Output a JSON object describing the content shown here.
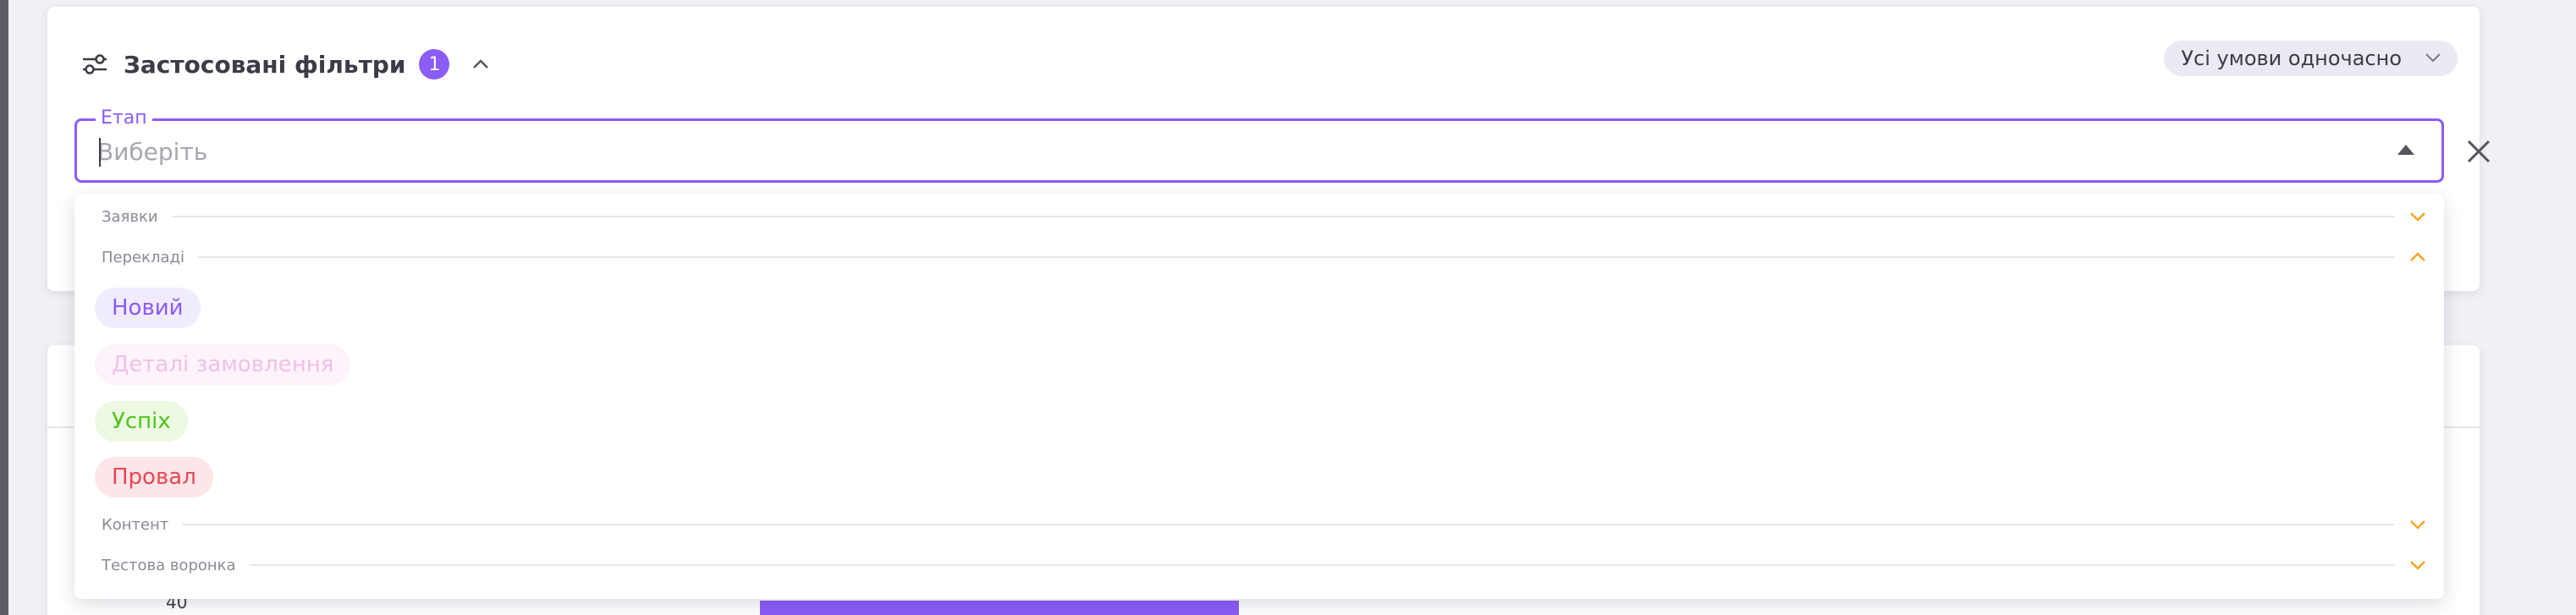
{
  "filters": {
    "title": "Застосовані фільтри",
    "count": "1",
    "mode": "Усі умови одночасно"
  },
  "stage_field": {
    "label": "Етап",
    "placeholder": "Виберіть"
  },
  "dropdown": {
    "groups": [
      {
        "label": "Заявки",
        "expanded": false
      },
      {
        "label": "Перекладі",
        "expanded": true
      },
      {
        "label": "Контент",
        "expanded": false
      },
      {
        "label": "Тестова воронка",
        "expanded": false
      }
    ],
    "options": [
      {
        "label": "Новий",
        "color": "#8b5cf6",
        "background": "#f1ecfd",
        "disabled": false
      },
      {
        "label": "Деталі замовлення",
        "color": "#f1c0e8",
        "background": "#fdf3fb",
        "disabled": true
      },
      {
        "label": "Успіх",
        "color": "#52c41a",
        "background": "#ecf9e3",
        "disabled": false
      },
      {
        "label": "Провал",
        "color": "#e84855",
        "background": "#fde6e8",
        "disabled": false
      }
    ]
  },
  "chart": {
    "tick_label": "40"
  },
  "colors": {
    "accent": "#8b5cf6",
    "chevron": "#f5a623"
  },
  "icons": [
    "sliders-icon",
    "chevron-up-icon",
    "chevron-down-icon",
    "arrow-up-icon",
    "close-icon",
    "menu-icon"
  ]
}
